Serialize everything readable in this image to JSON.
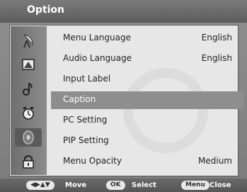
{
  "window": {
    "title": "Option"
  },
  "sidebar": {
    "icons": [
      {
        "name": "satellite-dish-icon",
        "selected": false
      },
      {
        "name": "picture-icon",
        "selected": false
      },
      {
        "name": "sound-icon",
        "selected": false
      },
      {
        "name": "alarm-clock-icon",
        "selected": false
      },
      {
        "name": "option-disc-icon",
        "selected": true
      },
      {
        "name": "lock-icon",
        "selected": false
      }
    ]
  },
  "menu": {
    "items": [
      {
        "label": "Menu Language",
        "value": "English"
      },
      {
        "label": "Audio Language",
        "value": "English"
      },
      {
        "label": "Input Label",
        "value": ""
      },
      {
        "label": "Caption",
        "value": ""
      },
      {
        "label": "PC Setting",
        "value": ""
      },
      {
        "label": "PIP Setting",
        "value": ""
      },
      {
        "label": "Menu Opacity",
        "value": "Medium"
      }
    ],
    "highlighted_index": 3
  },
  "footer": {
    "move_key": "◀▶▲▼",
    "move_label": "Move",
    "select_key": "OK",
    "select_label": "Select",
    "close_key": "Menu",
    "close_label": "Close"
  }
}
